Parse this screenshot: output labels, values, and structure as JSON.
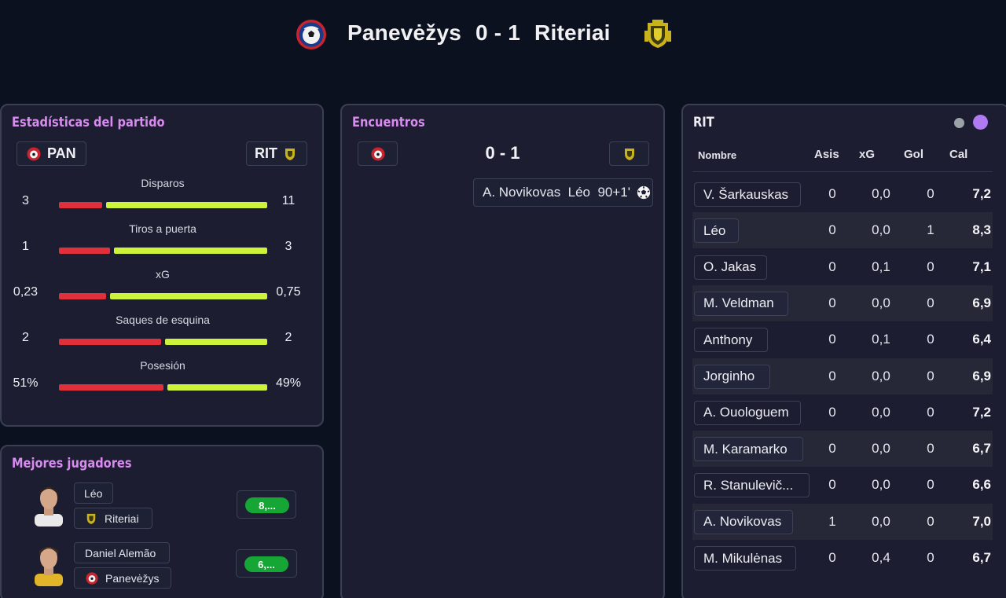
{
  "match": {
    "home": "Panevėžys",
    "score": "0 - 1",
    "away": "Riteriai"
  },
  "stats_panel": {
    "title": "Estadísticas del partido",
    "home_abbr": "PAN",
    "away_abbr": "RIT",
    "stats": [
      {
        "label": "Disparos",
        "home": "3",
        "away": "11",
        "home_share": 0.21
      },
      {
        "label": "Tiros a puerta",
        "home": "1",
        "away": "3",
        "home_share": 0.25
      },
      {
        "label": "xG",
        "home": "0,23",
        "away": "0,75",
        "home_share": 0.23
      },
      {
        "label": "Saques de esquina",
        "home": "2",
        "away": "2",
        "home_share": 0.5
      },
      {
        "label": "Posesión",
        "home": "51%",
        "away": "49%",
        "home_share": 0.51
      }
    ],
    "colors": {
      "home": "#e0303c",
      "away": "#cdf23a"
    }
  },
  "best_players": {
    "title": "Mejores jugadores",
    "players": [
      {
        "name": "Léo",
        "team": "Riteriai",
        "rating": "8,..."
      },
      {
        "name": "Daniel Alemão",
        "team": "Panevėžys",
        "rating": "6,..."
      }
    ]
  },
  "events_panel": {
    "title": "Encuentros",
    "score": "0 - 1",
    "events": [
      {
        "text": "A. Novikovas  Léo  90+1'",
        "icon": "ball-icon"
      }
    ]
  },
  "team_table": {
    "title": "RIT",
    "headers": {
      "name": "Nombre",
      "assists": "Asis",
      "xg": "xG",
      "goals": "Gol",
      "rating": "Cal"
    },
    "rows": [
      {
        "name": "V. Šarkauskas",
        "assists": "0",
        "xg": "0,0",
        "goals": "0",
        "rating": "7,2"
      },
      {
        "name": "Léo",
        "assists": "0",
        "xg": "0,0",
        "goals": "1",
        "rating": "8,3"
      },
      {
        "name": "O. Jakas",
        "assists": "0",
        "xg": "0,1",
        "goals": "0",
        "rating": "7,1"
      },
      {
        "name": "M. Veldman",
        "assists": "0",
        "xg": "0,0",
        "goals": "0",
        "rating": "6,9"
      },
      {
        "name": "Anthony",
        "assists": "0",
        "xg": "0,1",
        "goals": "0",
        "rating": "6,4"
      },
      {
        "name": "Jorginho",
        "assists": "0",
        "xg": "0,0",
        "goals": "0",
        "rating": "6,9"
      },
      {
        "name": "A. Ouologuem",
        "assists": "0",
        "xg": "0,0",
        "goals": "0",
        "rating": "7,2"
      },
      {
        "name": "M. Karamarko",
        "assists": "0",
        "xg": "0,0",
        "goals": "0",
        "rating": "6,7"
      },
      {
        "name": "R. Stanulevič...",
        "assists": "0",
        "xg": "0,0",
        "goals": "0",
        "rating": "6,6"
      },
      {
        "name": "A. Novikovas",
        "assists": "1",
        "xg": "0,0",
        "goals": "0",
        "rating": "7,0"
      },
      {
        "name": "M. Mikulėnas",
        "assists": "0",
        "xg": "0,4",
        "goals": "0",
        "rating": "6,7"
      }
    ],
    "dot_colors": [
      "#9aa3a8",
      "#b07af2"
    ]
  }
}
